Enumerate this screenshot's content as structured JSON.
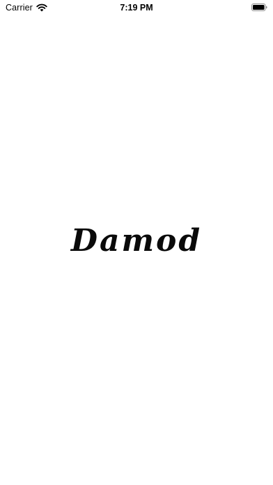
{
  "status_bar": {
    "carrier": "Carrier",
    "time": "7:19 PM",
    "wifi_icon": "wifi-icon",
    "battery_icon": "battery-icon"
  },
  "splash": {
    "logo_text": "Damod"
  }
}
